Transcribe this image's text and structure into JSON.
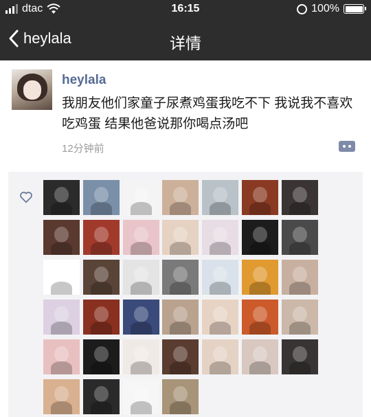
{
  "status_bar": {
    "carrier": "dtac",
    "time": "16:15",
    "battery": "100%"
  },
  "nav": {
    "back_label": "heylala",
    "title": "详情"
  },
  "post": {
    "author": "heylala",
    "text": "我朋友他们家童子尿煮鸡蛋我吃不下 我说我不喜欢吃鸡蛋 结果他爸说那你喝点汤吧",
    "time": "12分钟前"
  },
  "likes": {
    "avatar_colors": [
      "#2b2b2b",
      "#7a8fa8",
      "#f4f4f4",
      "#cdb09a",
      "#b8c2c8",
      "#8a3a22",
      "#3a3434",
      "#5a3a30",
      "#a23a2c",
      "#e9c4c8",
      "#e6d2c2",
      "#e8dde4",
      "#1c1c1c",
      "#4a4a4a",
      "#ffffff",
      "#5a4438",
      "#e4e4e4",
      "#7a7a7a",
      "#d9e2ea",
      "#e09a30",
      "#c8b0a0",
      "#dcd0e2",
      "#8a3020",
      "#3a4a7a",
      "#b9a28e",
      "#e7d3c4",
      "#cc5a2a",
      "#cbb8a8",
      "#e8c0c0",
      "#1c1c1c",
      "#f0eae6",
      "#5a3c30",
      "#e4d2c4",
      "#d8c8c0",
      "#383434",
      "#d9b090",
      "#2a2a2a",
      "#f6f6f6",
      "#a89478"
    ]
  }
}
